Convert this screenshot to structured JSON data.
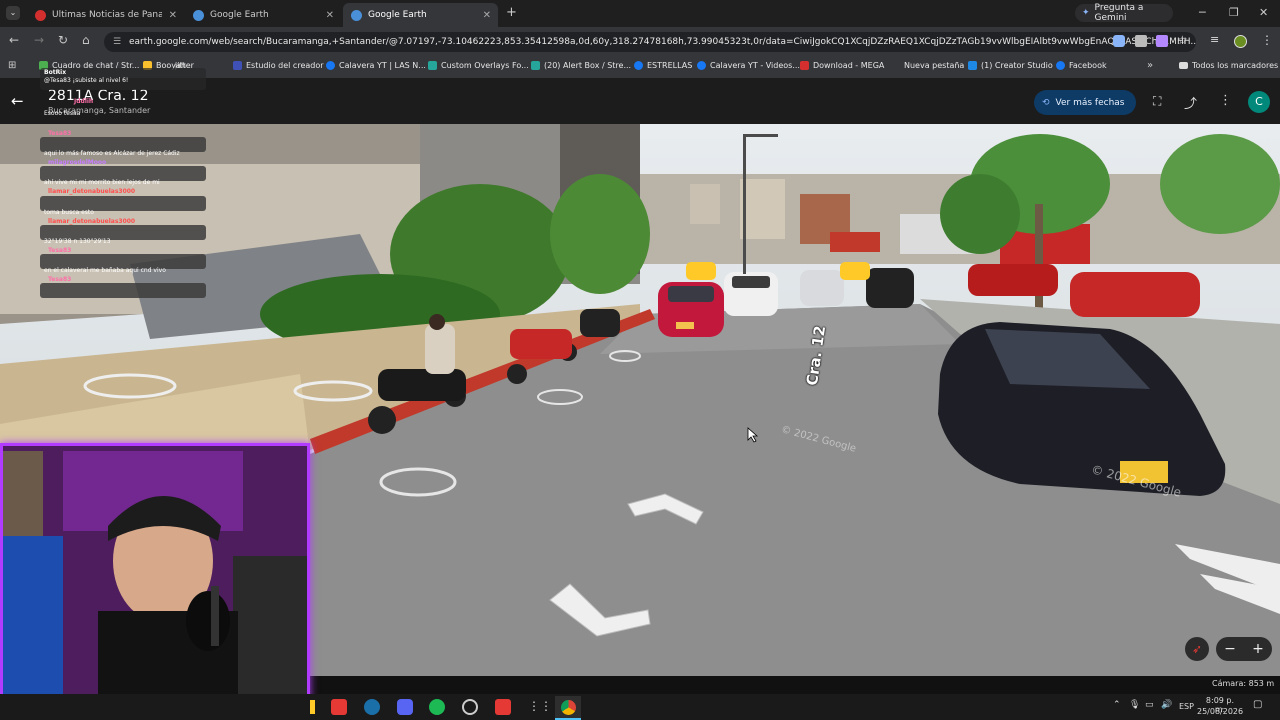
{
  "tabs": [
    {
      "title": "Últimas Noticias de Panamá En",
      "active": false
    },
    {
      "title": "Google Earth",
      "active": false
    },
    {
      "title": "Google Earth",
      "active": true
    }
  ],
  "gemini_label": "Pregunta a Gemini",
  "url": "earth.google.com/web/search/Bucaramanga,+Santander/@7.07197,-73.10462223,853.35412598a,0d,60y,318.27478168h,73.99045323t,0r/data=CiwiJgokCQ1XCqjDZzRAEQ1XCqjDZzTAGb19vvWlbgEIAlbt9vwWbgEnAQgIlASIaChZ1MHH...",
  "bookmarks": [
    "Cuadro de chat / Str...",
    "jitter",
    "Booyah",
    "Estudio del creador",
    "Calavera YT | LAS N...",
    "Custom Overlays Fo...",
    "(20) Alert Box / Stre...",
    "ESTRELLAS",
    "Calavera YT - Videos...",
    "Download - MEGA",
    "Nueva pestaña",
    "(1) Creator Studio",
    "Facebook"
  ],
  "all_bookmarks": "Todos los marcadores",
  "earth": {
    "title": "2811A Cra. 12",
    "subtitle": "Bucaramanga, Santander",
    "more_dates": "Ver más fechas",
    "avatar": "C",
    "camera": "Cámara: 853 m",
    "street_label": "Cra. 12",
    "copyright1": "© 2022 Google",
    "copyright2": "© 2022 Google"
  },
  "chat": {
    "header_user": "BotRix",
    "header_msg": "@Tesa83 ¡subiste al nivel 6!",
    "header_user2": "Jddlih",
    "header_msg2": "Esooo tesaa",
    "messages": [
      {
        "user": "Tesa83",
        "text": "aqui lo más famoso es Alcázar de jerez Cádiz",
        "color": "#ff6fa8"
      },
      {
        "user": "milagrosdelMooo",
        "text": "ahí vive mi mi morrito bien lejos de mi",
        "color": "#c77dff"
      },
      {
        "user": "llamar_detonabuelas3000",
        "text": "toma busca esto",
        "color": "#ff4d4d"
      },
      {
        "user": "llamar_detonabuelas3000",
        "text": "32°19'38 n 130°29'13",
        "color": "#ff4d4d"
      },
      {
        "user": "Tesa83",
        "text": "en el calaveral me bañaba aqui cnd vivo",
        "color": "#ff6fa8"
      },
      {
        "user": "Tesa83",
        "text": "",
        "color": "#ff6fa8"
      }
    ]
  },
  "taskbar": {
    "lang": "ESP",
    "time": "8:09 p. m.",
    "date": "25/08/2026"
  },
  "colors": {
    "accent": "#1a73e8",
    "tab_active": "#35363a",
    "chrome_dark": "#1f1f1f"
  }
}
